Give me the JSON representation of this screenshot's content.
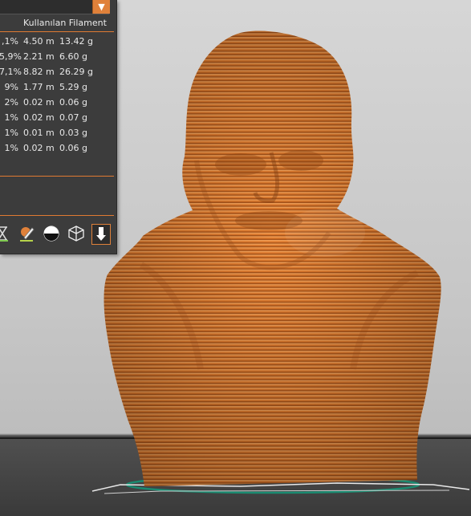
{
  "panel": {
    "header": "Kullanılan Filament",
    "dropdown_icon": "chevron-down-icon",
    "rows": [
      {
        "pct": ",1%",
        "length": "4.50 m",
        "weight": "13.42 g"
      },
      {
        "pct": "5,9%",
        "length": "2.21 m",
        "weight": "6.60 g"
      },
      {
        "pct": "7,1%",
        "length": "8.82 m",
        "weight": "26.29 g"
      },
      {
        "pct": "9%",
        "length": "1.77 m",
        "weight": "5.29 g"
      },
      {
        "pct": "2%",
        "length": "0.02 m",
        "weight": "0.06 g"
      },
      {
        "pct": "1%",
        "length": "0.02 m",
        "weight": "0.07 g"
      },
      {
        "pct": "1%",
        "length": "0.01 m",
        "weight": "0.03 g"
      },
      {
        "pct": "1%",
        "length": "0.02 m",
        "weight": "0.06 g"
      }
    ],
    "toolbar_icons": [
      "hourglass-icon",
      "pencil-brush-icon",
      "half-circle-icon",
      "wireframe-cube-icon",
      "export-arrow-icon"
    ]
  },
  "colors": {
    "accent": "#e0813a",
    "model": "#e07b2e",
    "panel_bg": "#3c3c3c",
    "bed": "#3e3e3e"
  }
}
